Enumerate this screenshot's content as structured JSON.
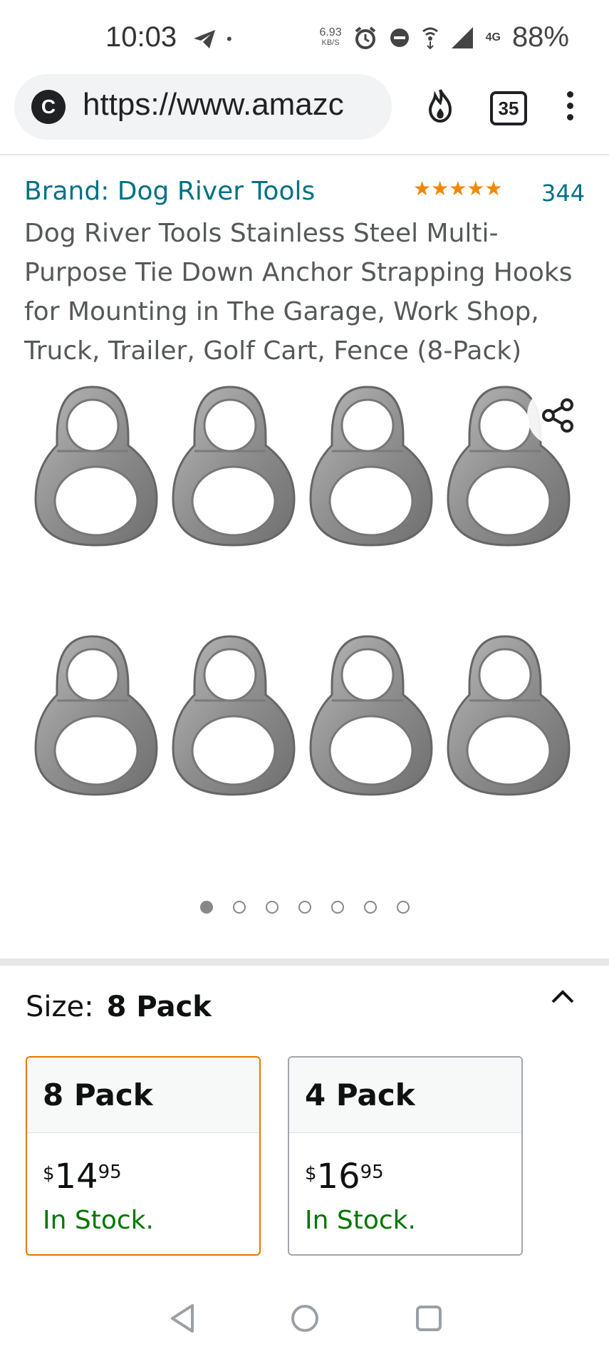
{
  "status_bar": {
    "time": "10:03",
    "net_speed_value": "6.93",
    "net_speed_unit": "KB/S",
    "network": "4G",
    "battery": "88%"
  },
  "browser": {
    "site_badge": "C",
    "url": "https://www.amazc",
    "tab_count": "35"
  },
  "product": {
    "brand": "Brand: Dog River Tools",
    "stars_text": "★★★★★",
    "rating_count": "344",
    "title": "Dog River Tools Stainless Steel Multi-Purpose Tie Down Anchor Strapping Hooks for Mounting in The Garage, Work Shop, Truck, Trailer, Golf Cart, Fence (8-Pack)",
    "image_dots_total": 7,
    "image_dot_active": 1
  },
  "size": {
    "label": "Size:",
    "selected": "8 Pack",
    "options": [
      {
        "name": "8 Pack",
        "currency": "$",
        "whole": "14",
        "fraction": "95",
        "stock": "In Stock."
      },
      {
        "name": "4 Pack",
        "currency": "$",
        "whole": "16",
        "fraction": "95",
        "stock": "In Stock."
      }
    ]
  },
  "colors": {
    "link": "#007185",
    "star": "#f08804",
    "in_stock": "#007600",
    "selected_border": "#e77600"
  }
}
